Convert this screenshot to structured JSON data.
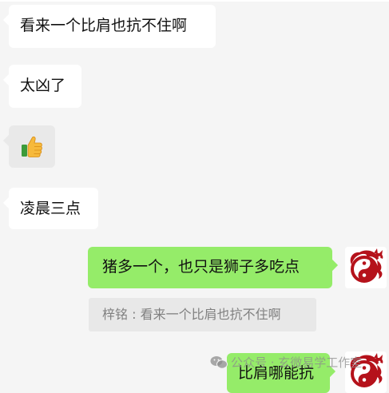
{
  "messages": [
    {
      "id": "msg1",
      "side": "left",
      "text": "看来一个比肩也抗不住啊"
    },
    {
      "id": "msg2",
      "side": "left",
      "text": "太凶了"
    },
    {
      "id": "msg3",
      "side": "left",
      "sticker": "thumbs-up-emoji"
    },
    {
      "id": "msg4",
      "side": "left",
      "text": "凌晨三点"
    },
    {
      "id": "msg5",
      "side": "right",
      "text": "猪多一个，也只是狮子多吃点"
    },
    {
      "id": "msg6",
      "side": "right",
      "text": "比肩哪能抗"
    }
  ],
  "quote": {
    "text": "梓铭 : 看来一个比肩也抗不住啊"
  },
  "watermark": {
    "icon": "wechat-icon",
    "text": "公众号 · 玄微易学工作室"
  },
  "colors": {
    "background": "#f5f5f5",
    "incoming_bubble": "#ffffff",
    "outgoing_bubble": "#95ec69",
    "quote_bg": "#e8e8e8",
    "quote_text": "#808080",
    "avatar_red": "#b5121b"
  }
}
